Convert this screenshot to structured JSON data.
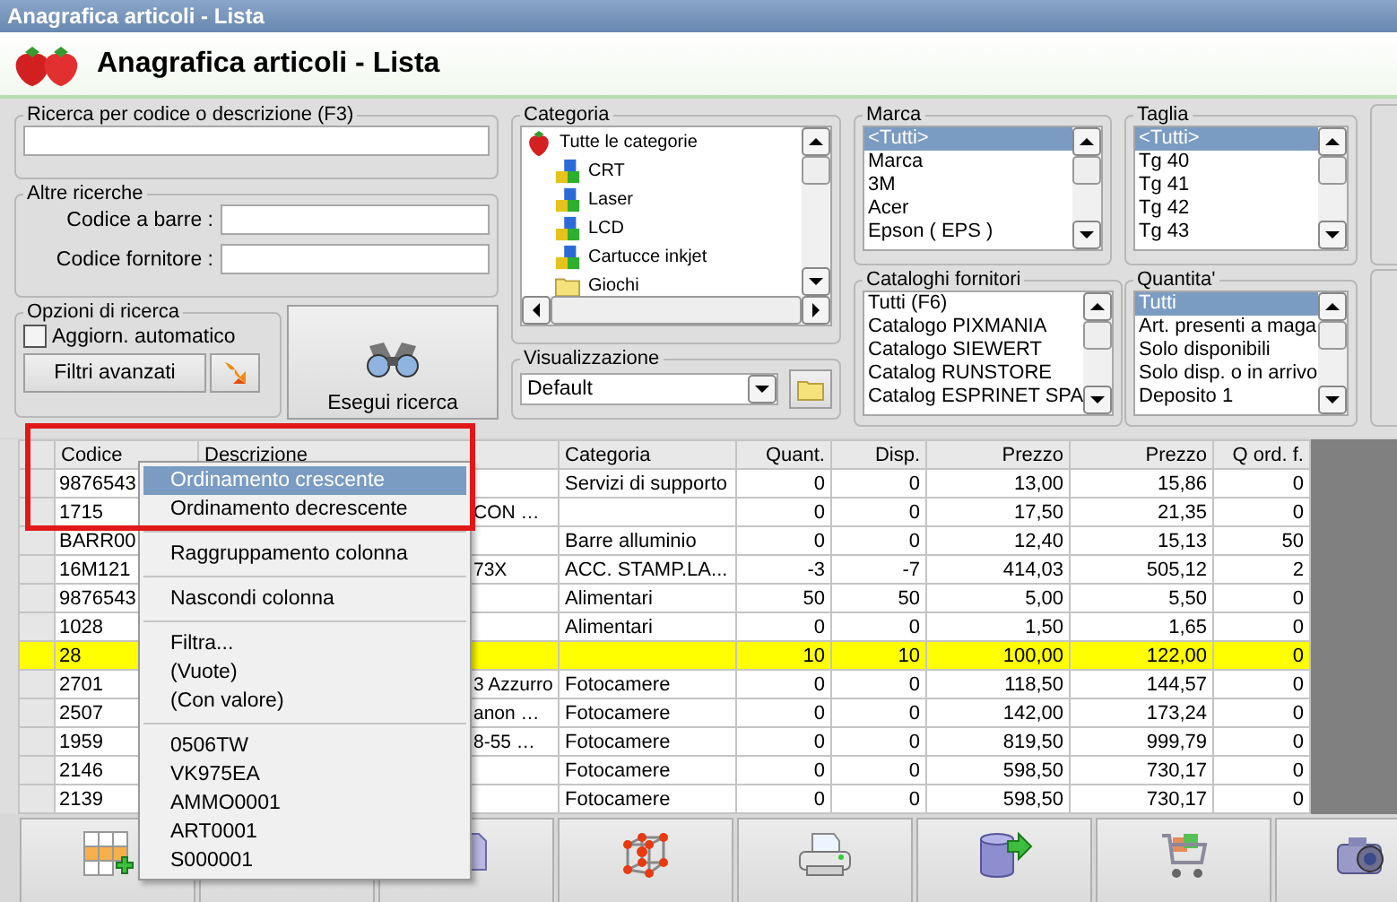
{
  "window": {
    "title": "Anagrafica articoli  - Lista"
  },
  "header": {
    "title": "Anagrafica articoli  - Lista"
  },
  "search": {
    "legend": "Ricerca per codice o descrizione (F3)"
  },
  "other_searches": {
    "legend": "Altre ricerche",
    "fields": [
      {
        "label": "Codice a barre :"
      },
      {
        "label": "Codice fornitore :"
      }
    ]
  },
  "search_options": {
    "legend": "Opzioni di ricerca",
    "auto_update": {
      "label": "Aggiorn. automatico",
      "checked": false
    },
    "advanced_filters_button": "Filtri avanzati"
  },
  "run_search_button": "Esegui ricerca",
  "category": {
    "legend": "Categoria",
    "tree": [
      {
        "label": "Tutte le categorie",
        "kind": "root",
        "children": [
          {
            "label": "CRT",
            "kind": "category"
          },
          {
            "label": "Laser",
            "kind": "category"
          },
          {
            "label": "LCD",
            "kind": "category"
          },
          {
            "label": "Cartucce inkjet",
            "kind": "category"
          },
          {
            "label": "Giochi",
            "kind": "folder"
          }
        ]
      }
    ]
  },
  "view": {
    "legend": "Visualizzazione",
    "value": "Default"
  },
  "brand": {
    "legend": "Marca",
    "items": [
      {
        "label": "<Tutti>",
        "selected": true
      },
      {
        "label": "Marca",
        "selected": false
      },
      {
        "label": "3M",
        "selected": false
      },
      {
        "label": "Acer",
        "selected": false
      },
      {
        "label": "Epson ( EPS )",
        "selected": false
      }
    ]
  },
  "supplier_catalogs": {
    "legend": "Cataloghi fornitori",
    "items": [
      {
        "label": "Tutti (F6)",
        "selected": false
      },
      {
        "label": "Catalogo PIXMANIA",
        "selected": false
      },
      {
        "label": "Catalogo SIEWERT",
        "selected": false
      },
      {
        "label": "Catalog RUNSTORE",
        "selected": false
      },
      {
        "label": "Catalog ESPRINET SPA",
        "selected": false
      }
    ]
  },
  "size": {
    "legend": "Taglia",
    "items": [
      {
        "label": "<Tutti>",
        "selected": true
      },
      {
        "label": "Tg 40",
        "selected": false
      },
      {
        "label": "Tg 41",
        "selected": false
      },
      {
        "label": "Tg 42",
        "selected": false
      },
      {
        "label": "Tg 43",
        "selected": false
      }
    ]
  },
  "quantity": {
    "legend": "Quantita'",
    "items": [
      {
        "label": "Tutti",
        "selected": true
      },
      {
        "label": "Art. presenti a maga",
        "selected": false
      },
      {
        "label": "Solo disponibili",
        "selected": false
      },
      {
        "label": "Solo disp. o in arrivo",
        "selected": false
      },
      {
        "label": "Deposito 1",
        "selected": false
      }
    ]
  },
  "table": {
    "columns": [
      "Codice",
      "Descrizione",
      "Categoria",
      "Quant.",
      "Disp.",
      "Prezzo",
      "Prezzo",
      "Q ord. f."
    ],
    "rows": [
      {
        "selected": false,
        "cells": [
          "9876543",
          "",
          "Servizi di supporto",
          "0",
          "0",
          "13,00",
          "15,86",
          "0"
        ]
      },
      {
        "selected": false,
        "cells": [
          "1715",
          "CON …",
          "",
          "0",
          "0",
          "17,50",
          "21,35",
          "0"
        ]
      },
      {
        "selected": false,
        "cells": [
          "BARR00",
          "",
          "Barre alluminio",
          "0",
          "0",
          "12,40",
          "15,13",
          "50"
        ]
      },
      {
        "selected": false,
        "cells": [
          "16M121",
          "73X",
          "ACC. STAMP.LA...",
          "-3",
          "-7",
          "414,03",
          "505,12",
          "2"
        ]
      },
      {
        "selected": false,
        "cells": [
          "9876543",
          "",
          "Alimentari",
          "50",
          "50",
          "5,00",
          "5,50",
          "0"
        ]
      },
      {
        "selected": false,
        "cells": [
          "1028",
          "",
          "Alimentari",
          "0",
          "0",
          "1,50",
          "1,65",
          "0"
        ]
      },
      {
        "selected": true,
        "cells": [
          "28",
          "",
          "",
          "10",
          "10",
          "100,00",
          "122,00",
          "0"
        ]
      },
      {
        "selected": false,
        "cells": [
          "2701",
          "3 Azzurro",
          "Fotocamere",
          "0",
          "0",
          "118,50",
          "144,57",
          "0"
        ]
      },
      {
        "selected": false,
        "cells": [
          "2507",
          "anon …",
          "Fotocamere",
          "0",
          "0",
          "142,00",
          "173,24",
          "0"
        ]
      },
      {
        "selected": false,
        "cells": [
          "1959",
          "8-55 …",
          "Fotocamere",
          "0",
          "0",
          "819,50",
          "999,79",
          "0"
        ]
      },
      {
        "selected": false,
        "cells": [
          "2146",
          "",
          "Fotocamere",
          "0",
          "0",
          "598,50",
          "730,17",
          "0"
        ]
      },
      {
        "selected": false,
        "cells": [
          "2139",
          "",
          "Fotocamere",
          "0",
          "0",
          "598,50",
          "730,17",
          "0"
        ]
      }
    ]
  },
  "context_menu": {
    "groups": [
      [
        {
          "label": "Ordinamento crescente",
          "selected": true
        },
        {
          "label": "Ordinamento decrescente",
          "selected": false
        }
      ],
      [
        {
          "label": "Raggruppamento colonna",
          "selected": false
        }
      ],
      [
        {
          "label": "Nascondi colonna",
          "selected": false
        }
      ],
      [
        {
          "label": "Filtra...",
          "selected": false
        },
        {
          "label": "(Vuote)",
          "selected": false
        },
        {
          "label": "(Con valore)",
          "selected": false
        }
      ],
      [
        {
          "label": "0506TW",
          "selected": false
        },
        {
          "label": "VK975EA",
          "selected": false
        },
        {
          "label": "AMMO0001",
          "selected": false
        },
        {
          "label": "ART0001",
          "selected": false
        },
        {
          "label": "S000001",
          "selected": false
        }
      ]
    ]
  }
}
